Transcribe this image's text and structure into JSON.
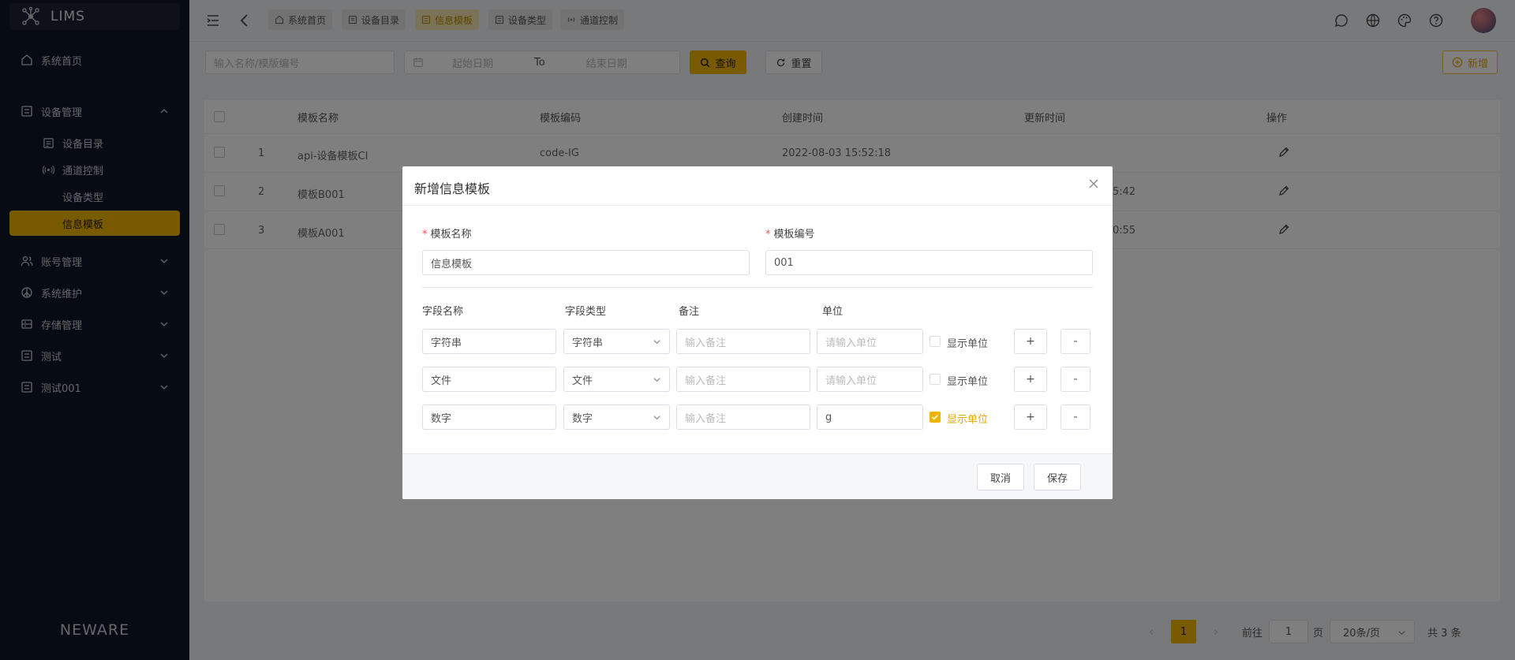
{
  "app": {
    "title": "LIMS",
    "brand": "NEWARE"
  },
  "sidebar": {
    "items": [
      {
        "label": "系统首页"
      },
      {
        "label": "设备管理"
      },
      {
        "label": "设备目录"
      },
      {
        "label": "通道控制"
      },
      {
        "label": "设备类型"
      },
      {
        "label": "信息模板"
      },
      {
        "label": "账号管理"
      },
      {
        "label": "系统维护"
      },
      {
        "label": "存储管理"
      },
      {
        "label": "测试"
      },
      {
        "label": "测试001"
      }
    ]
  },
  "tabs": [
    {
      "label": "系统首页"
    },
    {
      "label": "设备目录"
    },
    {
      "label": "信息模板"
    },
    {
      "label": "设备类型"
    },
    {
      "label": "通道控制"
    }
  ],
  "colors": {
    "accent": "#f0b400",
    "sidebar": "#0f1626",
    "required": "#ee5555"
  },
  "search": {
    "name_placeholder": "输入名称/模版编号",
    "start_placeholder": "起始日期",
    "to_label": "To",
    "end_placeholder": "结束日期",
    "query_label": "查询",
    "reset_label": "重置",
    "add_label": "新增"
  },
  "table": {
    "headers": [
      "模板名称",
      "模板编码",
      "创建时间",
      "更新时间",
      "操作"
    ],
    "rows": [
      {
        "index": "1",
        "name": "api-设备模板CI",
        "code": "code-IG",
        "created": "2022-08-03 15:52:18",
        "updated": ""
      },
      {
        "index": "2",
        "name": "模板B001",
        "code": "",
        "created": "",
        "updated": "5:42"
      },
      {
        "index": "3",
        "name": "模板A001",
        "code": "",
        "created": "",
        "updated": "0:55"
      }
    ]
  },
  "pagination": {
    "current": "1",
    "goto_label": "前往",
    "goto_value": "1",
    "page_suffix": "页",
    "page_size": "20条/页",
    "total": "共 3 条"
  },
  "modal": {
    "title": "新增信息模板",
    "name_label": "模板名称",
    "name_value": "信息模板",
    "code_label": "模板编号",
    "code_value": "001",
    "col_field_name": "字段名称",
    "col_field_type": "字段类型",
    "col_remark": "备注",
    "col_unit": "单位",
    "remark_placeholder": "输入备注",
    "unit_placeholder": "请输入单位",
    "show_unit_label": "显示单位",
    "plus_label": "+",
    "minus_label": "-",
    "fields": [
      {
        "name": "字符串",
        "type": "字符串",
        "unit": "",
        "show_unit": false
      },
      {
        "name": "文件",
        "type": "文件",
        "unit": "",
        "show_unit": false
      },
      {
        "name": "数字",
        "type": "数字",
        "unit": "g",
        "show_unit": true
      }
    ],
    "cancel_label": "取消",
    "save_label": "保存"
  }
}
